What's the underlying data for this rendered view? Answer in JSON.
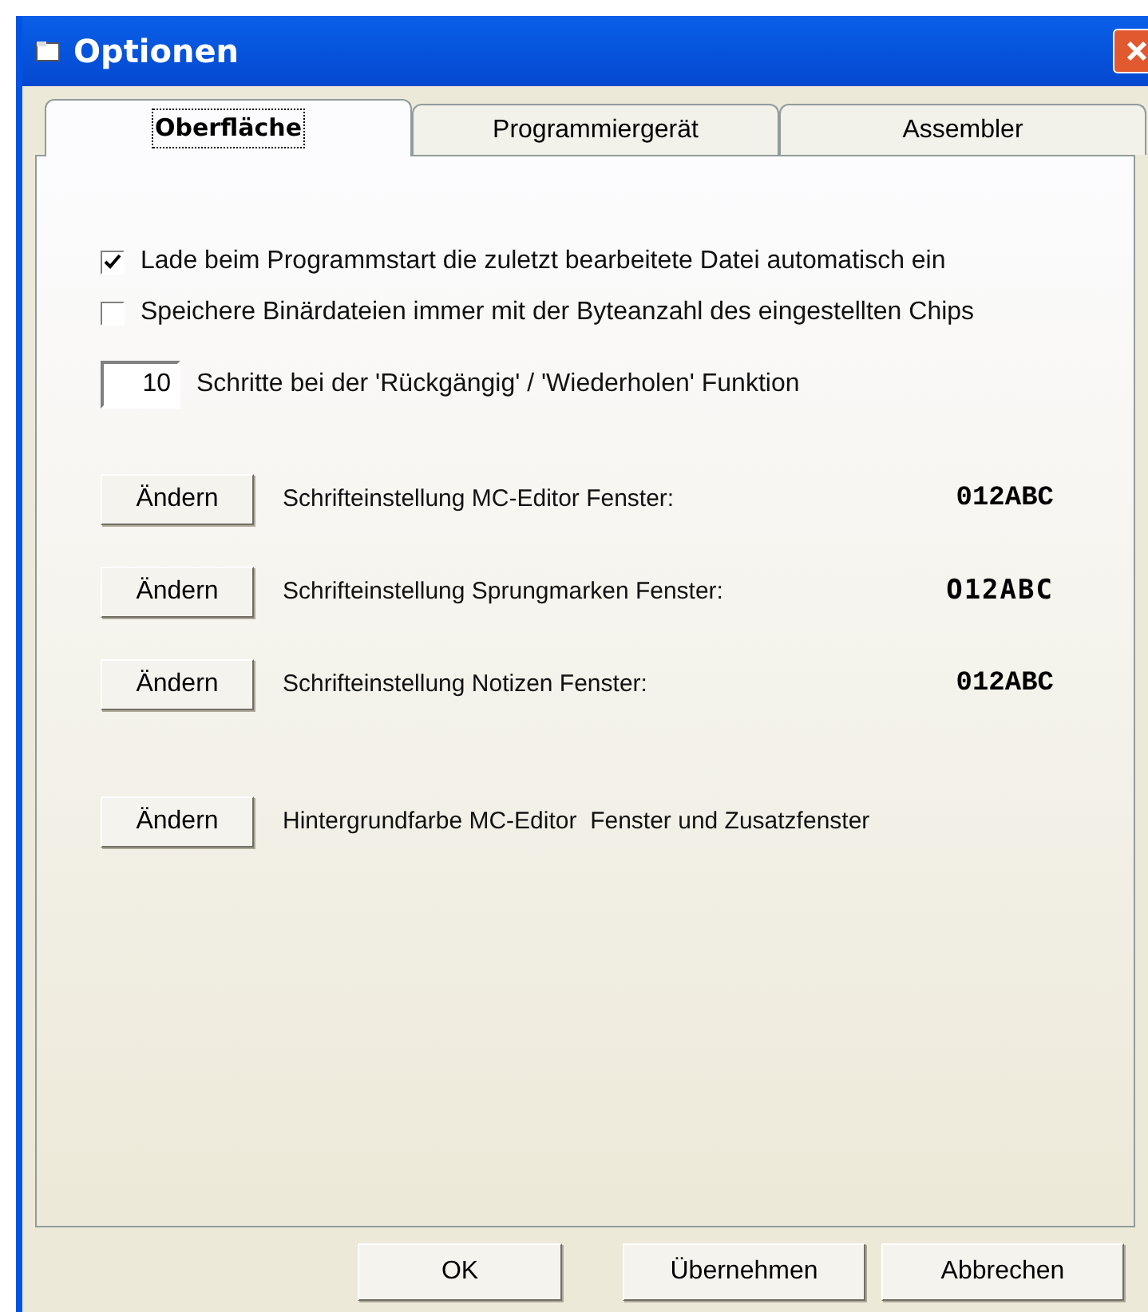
{
  "window": {
    "title": "Optionen"
  },
  "tabs": [
    {
      "label": "Oberfläche",
      "selected": true
    },
    {
      "label": "Programmiergerät",
      "selected": false
    },
    {
      "label": "Assembler",
      "selected": false
    }
  ],
  "checkboxes": [
    {
      "label": "Lade beim Programmstart die zuletzt bearbeitete Datei automatisch ein",
      "checked": true
    },
    {
      "label": "Speichere Binärdateien immer mit der Byteanzahl des eingestellten Chips",
      "checked": false
    }
  ],
  "undo_steps": {
    "value": "10",
    "label": "Schritte bei der 'Rückgängig' / 'Wiederholen' Funktion"
  },
  "font_settings": [
    {
      "button": "Ändern",
      "label": "Schrifteinstellung MC-Editor Fenster:",
      "sample": "012ABC"
    },
    {
      "button": "Ändern",
      "label": "Schrifteinstellung Sprungmarken Fenster:",
      "sample": "O12ABC"
    },
    {
      "button": "Ändern",
      "label": "Schrifteinstellung Notizen Fenster:",
      "sample": "012ABC"
    }
  ],
  "background_setting": {
    "button": "Ändern",
    "label": "Hintergrundfarbe MC-Editor  Fenster und Zusatzfenster"
  },
  "buttons": [
    "OK",
    "Übernehmen",
    "Abbrechen"
  ]
}
